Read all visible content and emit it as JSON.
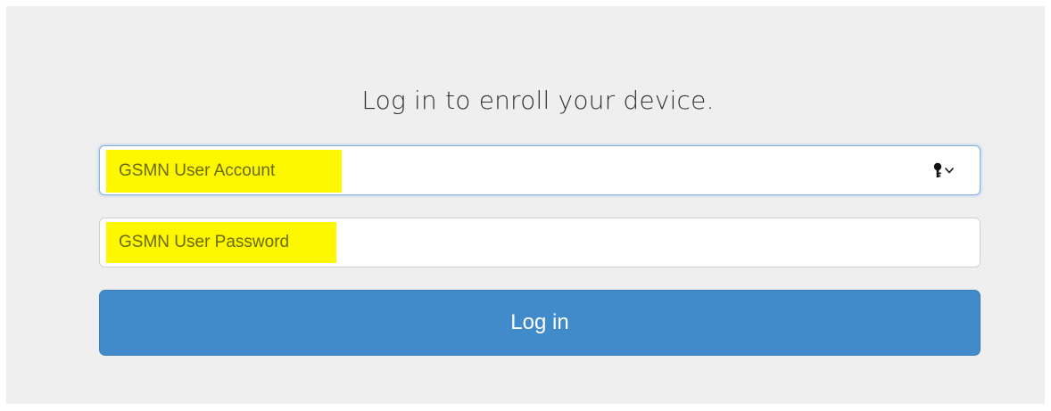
{
  "heading": "Log in to enroll your device.",
  "account_field": {
    "placeholder": "GSMN User Account",
    "value": "",
    "highlight_label": "GSMN User Account",
    "highlight_color": "#fdf700"
  },
  "password_field": {
    "placeholder": "GSMN User Password",
    "value": "",
    "highlight_label": "GSMN User Password",
    "highlight_color": "#fdf700"
  },
  "password_manager": {
    "icon": "key-icon",
    "dropdown_icon": "chevron-down-icon"
  },
  "login_button": {
    "label": "Log in",
    "color": "#428bca"
  }
}
